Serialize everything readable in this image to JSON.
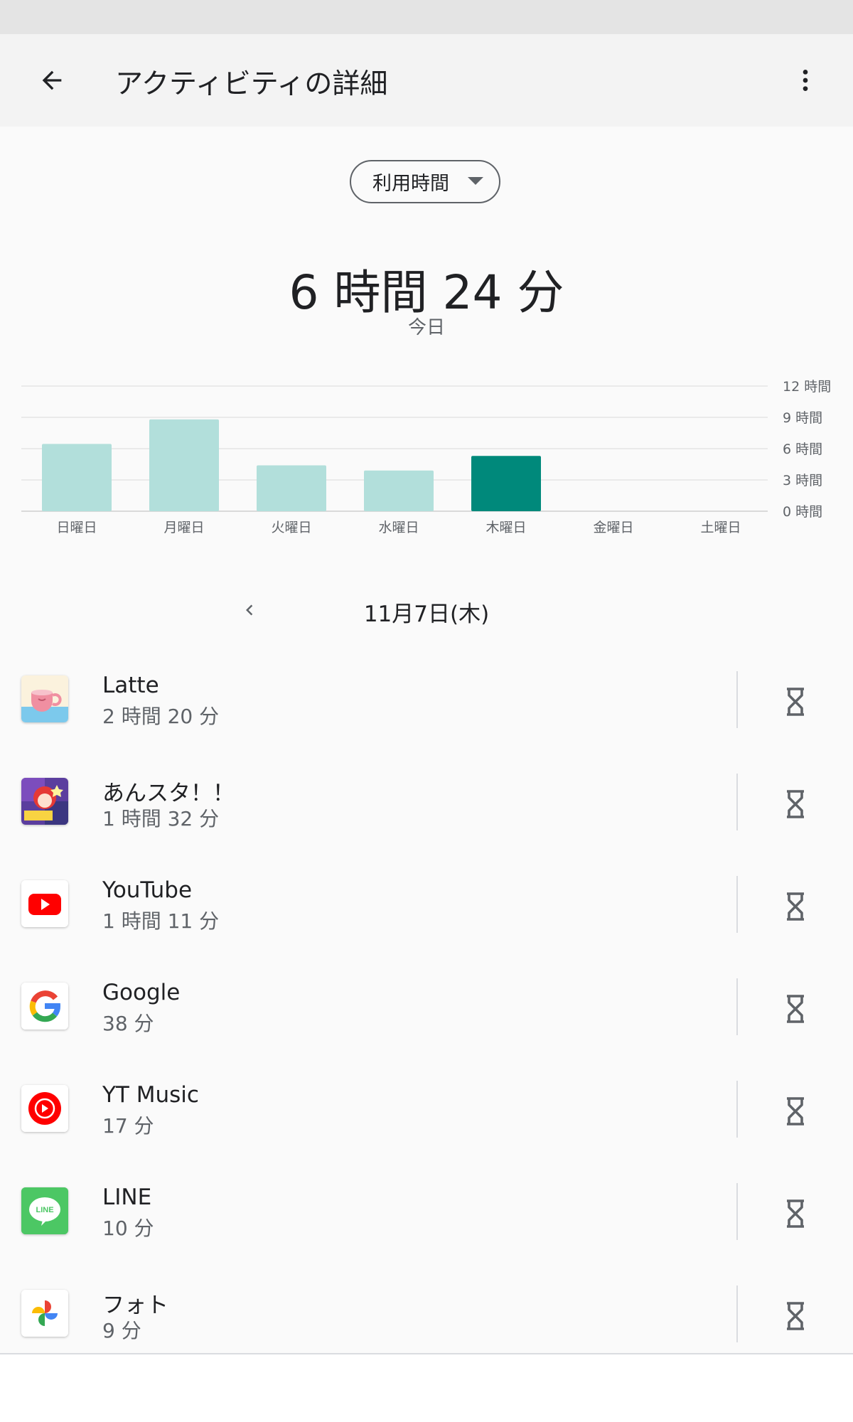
{
  "app_bar": {
    "title": "アクティビティの詳細",
    "back_icon": "arrow-back-icon",
    "more_icon": "more-vert-icon"
  },
  "metric_selector": {
    "selected": "利用時間"
  },
  "summary": {
    "total_time": "6 時間 24 分",
    "period": "今日"
  },
  "chart_data": {
    "type": "bar",
    "categories": [
      "日曜日",
      "月曜日",
      "火曜日",
      "水曜日",
      "木曜日",
      "金曜日",
      "土曜日"
    ],
    "values": [
      6.45,
      8.8,
      4.4,
      3.9,
      5.3,
      null,
      null
    ],
    "highlight_index": 4,
    "y_ticks": [
      0,
      3,
      6,
      9,
      12
    ],
    "y_tick_labels": [
      "0 時間",
      "3 時間",
      "6 時間",
      "9 時間",
      "12 時間"
    ],
    "ylim": [
      0,
      12
    ],
    "grid": true,
    "colors": {
      "bar": "#b2dfdb",
      "bar_highlight": "#00897b",
      "grid": "#e4e4e4",
      "axis_text": "#5f6368"
    }
  },
  "date_nav": {
    "date": "11月7日(木)",
    "prev_icon": "chevron-left-icon"
  },
  "apps": [
    {
      "name": "Latte",
      "time": "2 時間 20 分",
      "icon": "latte-app-icon"
    },
    {
      "name": "あんスタ！！",
      "time": "1 時間 32 分",
      "icon": "ensemble-stars-app-icon"
    },
    {
      "name": "YouTube",
      "time": "1 時間 11 分",
      "icon": "youtube-app-icon"
    },
    {
      "name": "Google",
      "time": "38 分",
      "icon": "google-app-icon"
    },
    {
      "name": "YT Music",
      "time": "17 分",
      "icon": "yt-music-app-icon"
    },
    {
      "name": "LINE",
      "time": "10 分",
      "icon": "line-app-icon",
      "icon_text": "LINE"
    },
    {
      "name": "フォト",
      "time": "9 分",
      "icon": "google-photos-app-icon"
    }
  ]
}
